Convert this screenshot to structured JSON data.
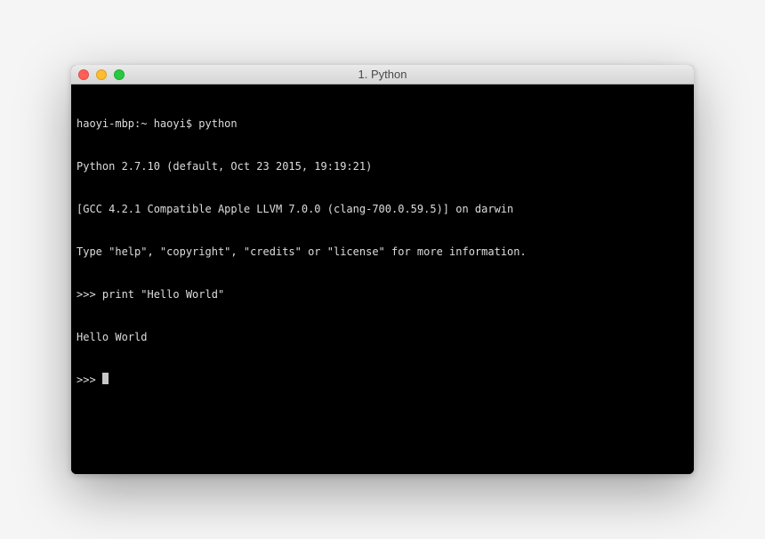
{
  "window": {
    "title": "1. Python"
  },
  "terminal": {
    "shell_prompt": "haoyi-mbp:~ haoyi$ ",
    "command": "python",
    "lines": [
      "Python 2.7.10 (default, Oct 23 2015, 19:19:21)",
      "[GCC 4.2.1 Compatible Apple LLVM 7.0.0 (clang-700.0.59.5)] on darwin",
      "Type \"help\", \"copyright\", \"credits\" or \"license\" for more information."
    ],
    "repl_prompt": ">>> ",
    "input1": "print \"Hello World\"",
    "output1": "Hello World"
  }
}
